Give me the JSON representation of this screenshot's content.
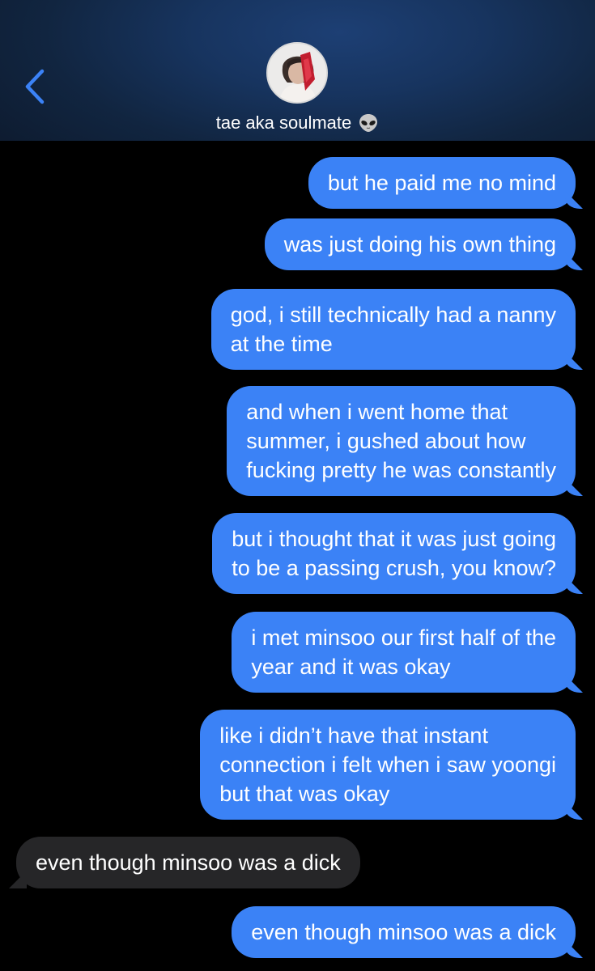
{
  "header": {
    "contact_name": "tae aka soulmate",
    "name_emoji": "alien-emoji-icon",
    "back_icon": "chevron-left-icon",
    "accent_color": "#3b82f6"
  },
  "messages": [
    {
      "direction": "sent",
      "lines": [
        "but he paid me no mind"
      ]
    },
    {
      "direction": "sent",
      "lines": [
        "was just doing his own thing"
      ]
    },
    {
      "direction": "sent",
      "lines": [
        "god, i still technically had a nanny",
        "at the time"
      ]
    },
    {
      "direction": "sent",
      "lines": [
        "and when i went home that",
        "summer, i gushed about how",
        "fucking pretty he was constantly"
      ]
    },
    {
      "direction": "sent",
      "lines": [
        "but i thought that it was just going",
        "to be a passing crush, you know?"
      ]
    },
    {
      "direction": "sent",
      "lines": [
        "i met minsoo our first half of the",
        "year and it was okay"
      ]
    },
    {
      "direction": "sent",
      "lines": [
        "like i didn’t have that instant",
        "connection i felt when i saw yoongi",
        "but that was okay"
      ]
    },
    {
      "direction": "received",
      "lines": [
        "even though minsoo was a dick"
      ]
    },
    {
      "direction": "sent",
      "lines": [
        "even though minsoo was a dick"
      ]
    }
  ]
}
